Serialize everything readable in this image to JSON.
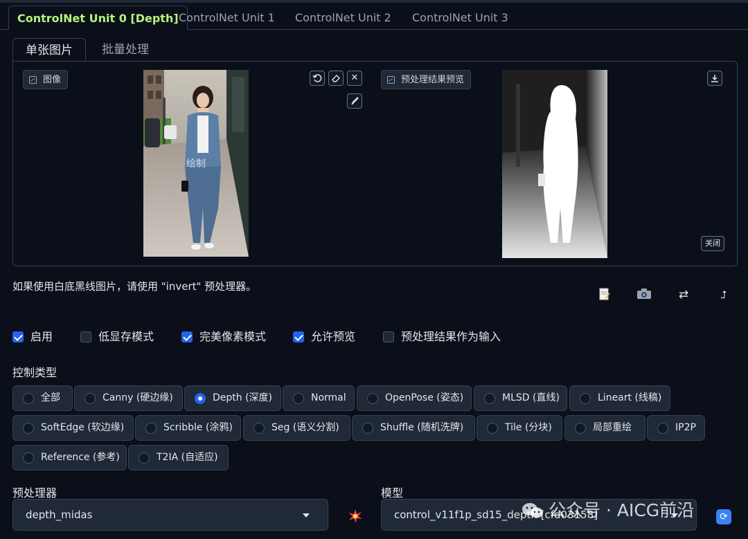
{
  "unit_tabs": [
    {
      "label": "ControlNet Unit 0 [Depth]",
      "active": true
    },
    {
      "label": "ControlNet Unit 1",
      "active": false
    },
    {
      "label": "ControlNet Unit 2",
      "active": false
    },
    {
      "label": "ControlNet Unit 3",
      "active": false
    }
  ],
  "sub_tabs": [
    {
      "label": "单张图片",
      "active": true
    },
    {
      "label": "批量处理",
      "active": false
    }
  ],
  "image_panel": {
    "label": "图像",
    "watermark_text": "绘制",
    "icons": [
      "undo-icon",
      "eraser-icon",
      "close-icon",
      "brush-icon"
    ]
  },
  "preview_panel": {
    "label": "预处理结果预览",
    "close_label": "关闭",
    "icons": [
      "download-icon"
    ]
  },
  "hint": "如果使用白底黑线图片，请使用 \"invert\" 预处理器。",
  "tools": [
    "notepad-icon",
    "camera-icon",
    "swap-icon",
    "send-dimensions-icon"
  ],
  "checkboxes": [
    {
      "label": "启用",
      "checked": true
    },
    {
      "label": "低显存模式",
      "checked": false
    },
    {
      "label": "完美像素模式",
      "checked": true
    },
    {
      "label": "允许预览",
      "checked": true
    },
    {
      "label": "预处理结果作为输入",
      "checked": false
    }
  ],
  "control_type": {
    "label": "控制类型",
    "options": [
      {
        "label": "全部",
        "selected": false
      },
      {
        "label": "Canny (硬边缘)",
        "selected": false
      },
      {
        "label": "Depth (深度)",
        "selected": true
      },
      {
        "label": "Normal",
        "selected": false
      },
      {
        "label": "OpenPose (姿态)",
        "selected": false
      },
      {
        "label": "MLSD (直线)",
        "selected": false
      },
      {
        "label": "Lineart (线稿)",
        "selected": false
      },
      {
        "label": "SoftEdge (软边缘)",
        "selected": false
      },
      {
        "label": "Scribble (涂鸦)",
        "selected": false
      },
      {
        "label": "Seg (语义分割)",
        "selected": false
      },
      {
        "label": "Shuffle (随机洗牌)",
        "selected": false
      },
      {
        "label": "Tile (分块)",
        "selected": false
      },
      {
        "label": "局部重绘",
        "selected": false
      },
      {
        "label": "IP2P",
        "selected": false
      },
      {
        "label": "Reference (参考)",
        "selected": false
      },
      {
        "label": "T2IA (自适应)",
        "selected": false
      }
    ]
  },
  "preprocessor": {
    "label": "预处理器",
    "value": "depth_midas"
  },
  "model": {
    "label": "模型",
    "value": "control_v11f1p_sd15_depth [cfd03158]"
  },
  "watermark": "公众号 · AICG前沿",
  "colors": {
    "accent": "#b4f47c",
    "checkbox": "#2563eb",
    "background": "#0b0f19",
    "panel": "#1f2937"
  }
}
